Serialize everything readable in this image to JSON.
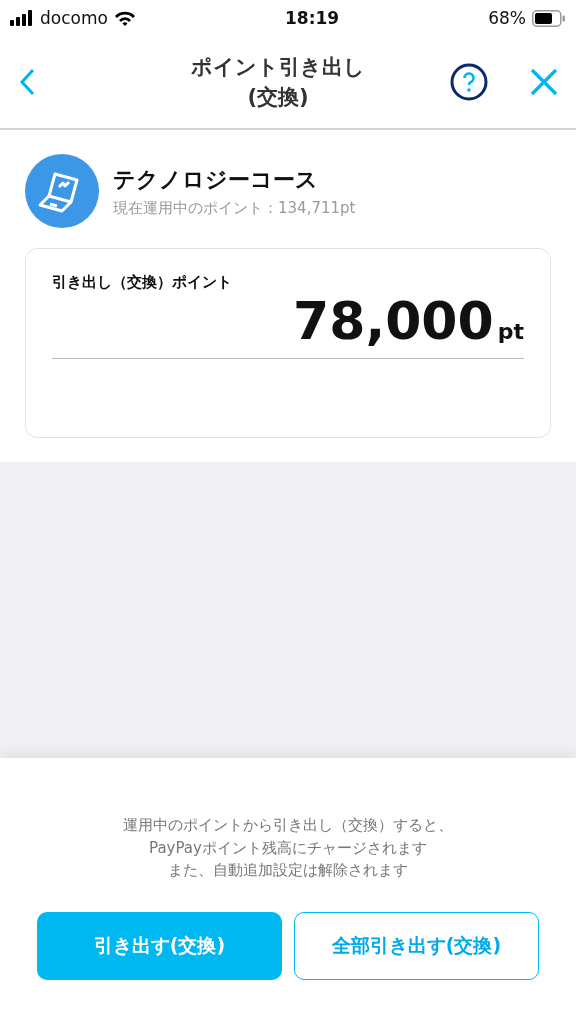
{
  "status_bar": {
    "carrier": "docomo",
    "time": "18:19",
    "battery": "68%"
  },
  "header": {
    "title": "ポイント引き出し\n(交換)"
  },
  "course": {
    "name": "テクノロジーコース",
    "points": "現在運用中のポイント：134,711pt"
  },
  "withdraw": {
    "label": "引き出し（交換）ポイント",
    "value": "78,000",
    "unit": "pt"
  },
  "notice": [
    "運用中のポイントから引き出し（交換）すると、",
    "PayPayポイント残高にチャージされます",
    "また、自動追加設定は解除されます"
  ],
  "buttons": [
    {
      "label": "引き出す(交換)",
      "kind": "primary"
    },
    {
      "label": "全部引き出す(交換)",
      "kind": "secondary"
    }
  ]
}
